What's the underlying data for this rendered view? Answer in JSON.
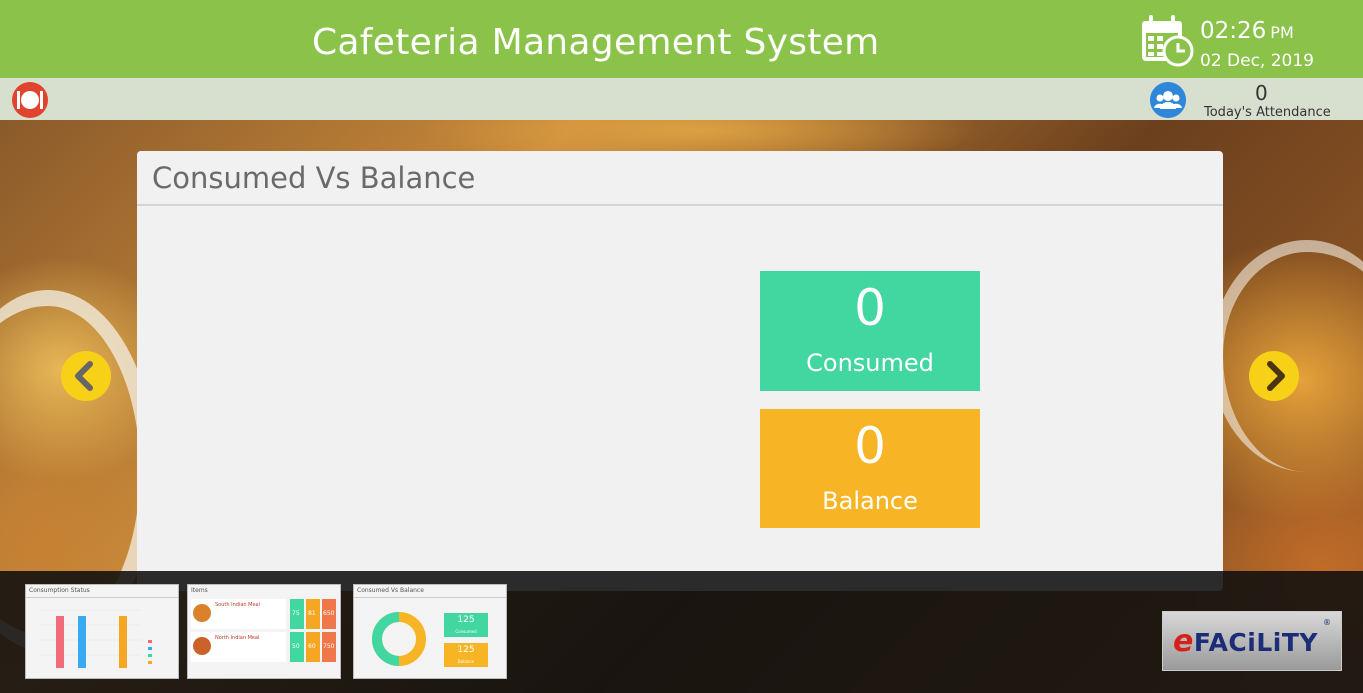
{
  "header": {
    "title": "Cafeteria Management System",
    "time": "02:26",
    "ampm": "PM",
    "date": "02 Dec, 2019"
  },
  "attendance": {
    "count": "0",
    "label": "Today's Attendance"
  },
  "panel": {
    "title": "Consumed Vs Balance",
    "consumed": {
      "value": "0",
      "label": "Consumed",
      "color": "#42d6a1"
    },
    "balance": {
      "value": "0",
      "label": "Balance",
      "color": "#f7b525"
    }
  },
  "thumbnails": [
    {
      "title": "Consumption Status"
    },
    {
      "title": "Items",
      "rows": [
        "South Indian Meal",
        "North Indian Meal"
      ],
      "values": [
        "75",
        "81",
        "650",
        "50",
        "60",
        "750"
      ]
    },
    {
      "title": "Consumed Vs Balance",
      "consumed_value": "125",
      "consumed_label": "Consumed",
      "balance_value": "125",
      "balance_label": "Balance"
    }
  ],
  "brand": {
    "e": "e",
    "text": "FACiLiTY",
    "reg": "®"
  },
  "colors": {
    "header": "#8bc34a",
    "subbar": "#d7dfcf",
    "arrow": "#f7d117"
  },
  "icons": {
    "calendar": "calendar-clock-icon",
    "users": "users-icon",
    "menu": "restaurant-logo-icon"
  }
}
